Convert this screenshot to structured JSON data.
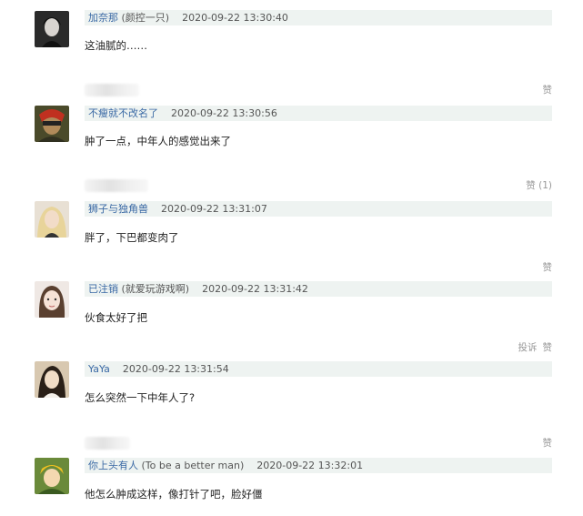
{
  "comments": [
    {
      "user": "加奈那",
      "sub": " (颜控一只)",
      "time": "2020-09-22 13:30:40",
      "text": "这油腻的……",
      "actions": {
        "report": "",
        "like": "赞"
      }
    },
    {
      "user": "不瘦就不改名了",
      "sub": "",
      "time": "2020-09-22 13:30:56",
      "text": "肿了一点，中年人的感觉出来了",
      "actions": {
        "report": "",
        "like": "赞 (1)"
      }
    },
    {
      "user": "狮子与独角兽",
      "sub": "",
      "time": "2020-09-22 13:31:07",
      "text": "胖了，下巴都变肉了",
      "actions": {
        "report": "",
        "like": "赞"
      }
    },
    {
      "user": "已注销",
      "sub": " (就爱玩游戏啊)",
      "time": "2020-09-22 13:31:42",
      "text": "伙食太好了把",
      "actions": {
        "report": "投诉",
        "like": "赞"
      }
    },
    {
      "user": "YaYa",
      "sub": "",
      "time": "2020-09-22 13:31:54",
      "text": "怎么突然一下中年人了?",
      "actions": {
        "report": "",
        "like": "赞"
      }
    },
    {
      "user": "你上头有人",
      "sub": " (To be a better man)",
      "time": "2020-09-22 13:32:01",
      "text": "他怎么肿成这样，像打针了吧，脸好僵",
      "actions": null
    }
  ],
  "colors": {
    "username": "#3b6aa5",
    "meta_bg": "#eef3f1",
    "muted": "#999999"
  }
}
